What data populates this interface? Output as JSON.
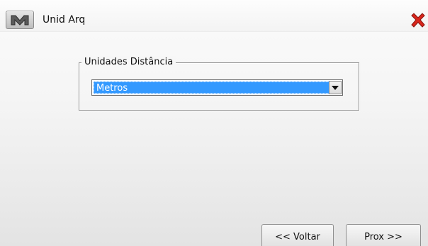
{
  "window": {
    "title": "Unid Arq",
    "menu_icon": "m-logo-icon",
    "close_icon": "close-x-icon",
    "close_color": "#d9261c"
  },
  "group": {
    "legend": "Unidades Distância",
    "select": {
      "selected": "Metros"
    }
  },
  "buttons": {
    "back_label": "<< Voltar",
    "next_label": "Prox >>"
  },
  "colors": {
    "selection": "#3399ff"
  }
}
